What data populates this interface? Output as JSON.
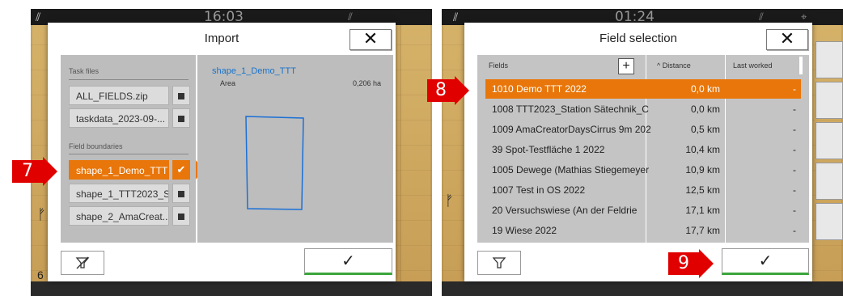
{
  "left_screen": {
    "clock": "16:03",
    "dialog": {
      "title": "Import",
      "close_label": "✕",
      "task_files_label": "Task files",
      "task_files": [
        "ALL_FIELDS.zip",
        "taskdata_2023-09-..."
      ],
      "field_boundaries_label": "Field boundaries",
      "field_boundaries": [
        {
          "label": "shape_1_Demo_TTT",
          "selected": true
        },
        {
          "label": "shape_1_TTT2023_S...",
          "selected": false
        },
        {
          "label": "shape_2_AmaCreat...",
          "selected": false
        }
      ],
      "preview": {
        "title": "shape_1_Demo_TTT",
        "area_label": "Area",
        "area_value": "0,206 ha"
      },
      "confirm_label": "✓",
      "filter_icon": "filter-off-icon"
    },
    "marker": "7"
  },
  "right_screen": {
    "clock": "01:24",
    "dialog": {
      "title": "Field selection",
      "close_label": "✕",
      "columns": {
        "fields": "Fields",
        "add": "+",
        "distance": "^ Distance",
        "last_worked": "Last worked"
      },
      "rows": [
        {
          "name": "1010 Demo TTT 2022",
          "distance": "0,0 km",
          "last": "-",
          "selected": true
        },
        {
          "name": "1008 TTT2023_Station Sätechnik_C",
          "distance": "0,0 km",
          "last": "-",
          "selected": false
        },
        {
          "name": "1009 AmaCreatorDaysCirrus 9m 202",
          "distance": "0,5 km",
          "last": "-",
          "selected": false
        },
        {
          "name": "39 Spot-Testfläche 1 2022",
          "distance": "10,4 km",
          "last": "-",
          "selected": false
        },
        {
          "name": "1005 Dewege (Mathias Stiegemeyer",
          "distance": "10,9 km",
          "last": "-",
          "selected": false
        },
        {
          "name": "1007 Test in OS 2022",
          "distance": "12,5 km",
          "last": "-",
          "selected": false
        },
        {
          "name": "20 Versuchswiese (An der Feldrie",
          "distance": "17,1 km",
          "last": "-",
          "selected": false
        },
        {
          "name": "19 Wiese 2022",
          "distance": "17,7 km",
          "last": "-",
          "selected": false
        }
      ],
      "confirm_label": "✓",
      "filter_icon": "filter-icon"
    },
    "markers": [
      "8",
      "9"
    ]
  },
  "colors": {
    "accent": "#e8760a",
    "marker": "#e10000",
    "link": "#1a73c9",
    "confirm_bar": "#3ba53b"
  }
}
